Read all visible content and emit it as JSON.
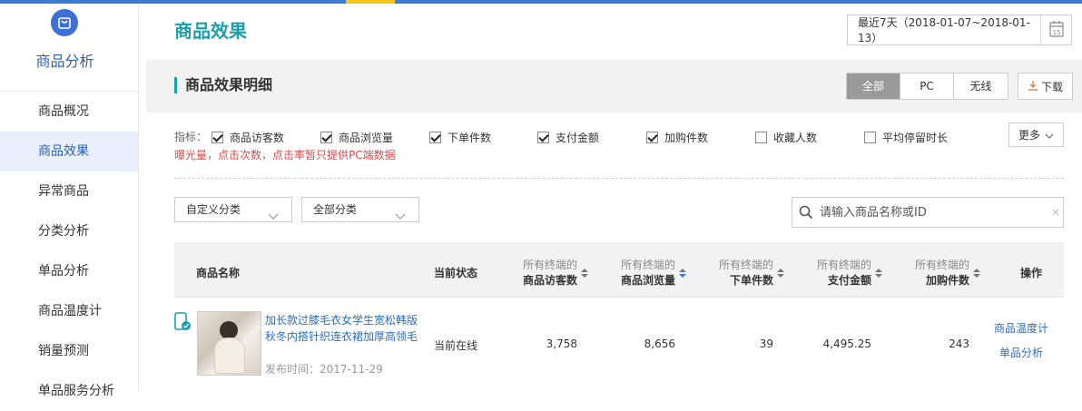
{
  "sidebar": {
    "title": "商品分析",
    "items": [
      {
        "label": "商品概况"
      },
      {
        "label": "商品效果"
      },
      {
        "label": "异常商品"
      },
      {
        "label": "分类分析"
      },
      {
        "label": "单品分析"
      },
      {
        "label": "商品温度计"
      },
      {
        "label": "销量预测"
      },
      {
        "label": "单品服务分析"
      }
    ]
  },
  "header": {
    "title": "商品效果",
    "date_range": "最近7天（2018-01-07~2018-01-13）",
    "calendar_day": "15"
  },
  "section": {
    "title": "商品效果明细",
    "tabs": [
      {
        "label": "全部"
      },
      {
        "label": "PC"
      },
      {
        "label": "无线"
      }
    ],
    "download_label": "下载"
  },
  "metrics": {
    "label": "指标：",
    "items": [
      {
        "label": "商品访客数",
        "checked": true
      },
      {
        "label": "商品浏览量",
        "checked": true
      },
      {
        "label": "下单件数",
        "checked": true
      },
      {
        "label": "支付金额",
        "checked": true
      },
      {
        "label": "加购件数",
        "checked": true
      },
      {
        "label": "收藏人数",
        "checked": false
      },
      {
        "label": "平均停留时长",
        "checked": false
      }
    ],
    "note": "曝光量，点击次数，点击率暂只提供PC端数据",
    "more_label": "更多"
  },
  "filters": {
    "category_custom": "自定义分类",
    "category_all": "全部分类",
    "search_placeholder": "请输入商品名称或ID"
  },
  "table": {
    "columns": {
      "name": "商品名称",
      "status": "当前状态",
      "visitors": {
        "sub": "所有终端的",
        "main": "商品访客数"
      },
      "views": {
        "sub": "所有终端的",
        "main": "商品浏览量"
      },
      "orders": {
        "sub": "所有终端的",
        "main": "下单件数"
      },
      "payment": {
        "sub": "所有终端的",
        "main": "支付金额"
      },
      "cart": {
        "sub": "所有终端的",
        "main": "加购件数"
      },
      "actions": "操作"
    },
    "rows": [
      {
        "name": "加长款过膝毛衣女学生宽松韩版秋冬内搭针织连衣裙加厚高领毛",
        "publish_date": "发布时间：2017-11-29",
        "status": "当前在线",
        "visitors": "3,758",
        "views": "8,656",
        "orders": "39",
        "payment": "4,495.25",
        "cart": "243",
        "action1": "商品温度计",
        "action2": "单品分析"
      }
    ]
  },
  "colors": {
    "accent": "#1aa0a8",
    "link": "#2b6cc4",
    "brand": "#3d6fd8",
    "warning": "#e04a4a"
  }
}
